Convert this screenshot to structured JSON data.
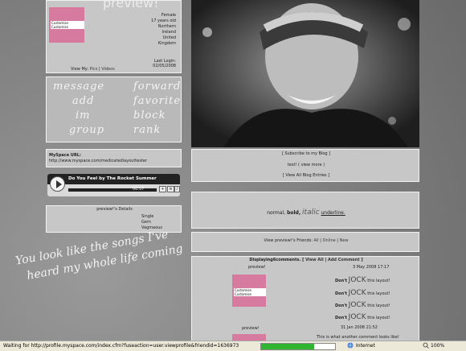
{
  "profile": {
    "title": "preview!",
    "photo_label": "Customise Customise",
    "info": [
      "Female",
      "17 years old",
      "Northern",
      "Ireland",
      "United",
      "Kingdom"
    ],
    "last_login_label": "Last Login:",
    "last_login": "02/05/2008",
    "view_my": "View My:",
    "view_pics": "Pics",
    "view_videos": "Videos"
  },
  "contact": {
    "message": "message",
    "forward": "forward",
    "add": "add",
    "favorite": "favorite",
    "im": "im",
    "block": "block",
    "group": "group",
    "rank": "rank"
  },
  "url": {
    "label": "MySpace URL:",
    "value": "http://www.myspace.com/medicatedlayouttester"
  },
  "player": {
    "song": "Do You Feel",
    "artist": "by The Rocket Summer",
    "time": "00:57"
  },
  "details": {
    "heading": "preview!'s Details",
    "rows": [
      "Single",
      "Gem",
      "Vagmaous"
    ]
  },
  "overlay": {
    "line1": "You look like the songs I've",
    "line2": "heard my whole life coming"
  },
  "blog": {
    "subscribe": "Subscribe to my Blog",
    "test": "test!",
    "view_more": "view more",
    "view_all": "View All Blog Entries"
  },
  "status": {
    "normal": "normal,",
    "bold": "bold,",
    "italic": "italic",
    "underline": "underline."
  },
  "friends": {
    "prefix": "View preview!'s Friends:",
    "all": "All",
    "online": "Online",
    "new": "New"
  },
  "comments": {
    "heading": "Displaying",
    "count": "6",
    "heading_suffix": "comments.",
    "view_all": "View All",
    "add": "Add Comment",
    "items": [
      {
        "name": "preview!",
        "date": "3 May 2008 17:17"
      },
      {
        "name": "preview!",
        "date": "31 Jan 2008 21:52"
      }
    ],
    "lines": [
      "Don't",
      "JOCK",
      "this layout!"
    ],
    "line2": "This is what another comment looks like!"
  },
  "statusbar": {
    "message": "Waiting for http://profile.myspace.com/index.cfm?fuseaction=user.viewprofile&friendid=1636973",
    "progress": 0.72,
    "zone": "Internet",
    "zoom": "100%"
  }
}
